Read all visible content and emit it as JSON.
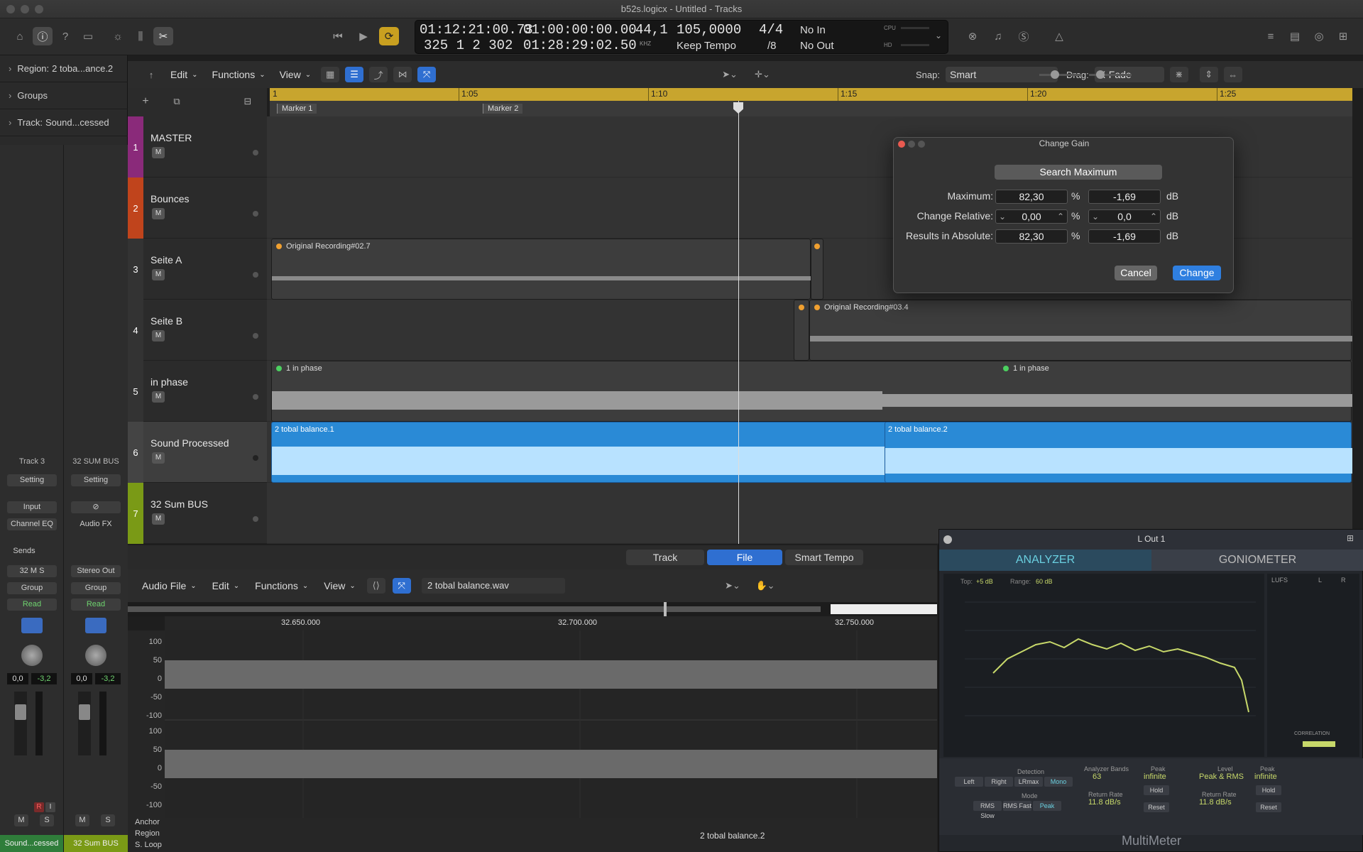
{
  "window": {
    "title": "b52s.logicx - Untitled - Tracks"
  },
  "lcd": {
    "time_main": "01:12:21:00.73",
    "time_bars": "325  1  2  302",
    "time_start": "01:00:00:00.00",
    "time_end": "01:28:29:02.50",
    "sample_rate": "44,1",
    "sample_rate_unit": "KHZ",
    "tempo": "105,0000",
    "tempo_mode": "Keep Tempo",
    "signature_top": "4/4",
    "signature_bottom": "/8",
    "punch_in": "No In",
    "punch_out": "No Out",
    "cpu": "CPU",
    "hd": "HD"
  },
  "inspector": {
    "region_label": "Region:",
    "region_value": "2 toba...ance.2",
    "groups": "Groups",
    "track_label": "Track:",
    "track_value": "Sound...cessed"
  },
  "strips": [
    {
      "name": "Track 3",
      "setting": "Setting",
      "input": "Input",
      "eq": "Channel EQ",
      "sends": "Sends",
      "io": "32 M S",
      "group": "Group",
      "auto": "Read",
      "vol": "0,0",
      "peak": "-3,2",
      "m": "M",
      "s": "S",
      "r": "R",
      "i": "I",
      "footer": "Sound...cessed",
      "footer_color": "#2f7d3a"
    },
    {
      "name": "32 SUM BUS",
      "setting": "Setting",
      "input": "",
      "eq": "Audio FX",
      "sends": "",
      "io": "Stereo Out",
      "group": "Group",
      "auto": "Read",
      "vol": "0,0",
      "peak": "-3,2",
      "m": "M",
      "s": "S",
      "r": "",
      "i": "",
      "footer": "32 Sum BUS",
      "footer_color": "#7a9a16"
    }
  ],
  "track_toolbar": {
    "edit": "Edit",
    "functions": "Functions",
    "view": "View",
    "snap_label": "Snap:",
    "snap_value": "Smart",
    "drag_label": "Drag:",
    "drag_value": "X-Fade"
  },
  "ruler": {
    "labels": [
      "1",
      "1:05",
      "1:10",
      "1:15",
      "1:20",
      "1:25"
    ],
    "markers": [
      "Marker 1",
      "Marker 2"
    ]
  },
  "tracks": [
    {
      "num": "1",
      "name": "MASTER",
      "m": "M",
      "color": "#8a2a7a"
    },
    {
      "num": "2",
      "name": "Bounces",
      "m": "M",
      "color": "#c0441c"
    },
    {
      "num": "3",
      "name": "Seite A",
      "m": "M",
      "color": "#3a3a3a"
    },
    {
      "num": "4",
      "name": "Seite B",
      "m": "M",
      "color": "#3a3a3a"
    },
    {
      "num": "5",
      "name": "in phase",
      "m": "M",
      "color": "#3a3a3a"
    },
    {
      "num": "6",
      "name": "Sound Processed",
      "m": "M",
      "color": "#3a3a3a"
    },
    {
      "num": "7",
      "name": "32 Sum BUS",
      "m": "M",
      "color": "#7a9a16"
    }
  ],
  "regions": {
    "r3": "Original Recording#02.7",
    "r4": "Original Recording#03.4",
    "r5a": "1 in phase",
    "r5b": "1 in phase",
    "r6a": "2 tobal balance.1",
    "r6b": "2 tobal balance.2"
  },
  "change_gain": {
    "title": "Change Gain",
    "search": "Search Maximum",
    "max_label": "Maximum:",
    "max_pct": "82,30",
    "max_db": "-1,69",
    "rel_label": "Change Relative:",
    "rel_pct": "0,00",
    "rel_db": "0,0",
    "abs_label": "Results in Absolute:",
    "abs_pct": "82,30",
    "abs_db": "-1,69",
    "pct": "%",
    "db": "dB",
    "cancel": "Cancel",
    "change": "Change"
  },
  "editor": {
    "tab_track": "Track",
    "tab_file": "File",
    "tab_smart": "Smart Tempo",
    "audio_file": "Audio File",
    "edit": "Edit",
    "functions": "Functions",
    "view": "View",
    "filename": "2 tobal balance.wav",
    "ruler": [
      "32.650.000",
      "32.700.000",
      "32.750.000"
    ],
    "axis": [
      "100",
      "50",
      "0",
      "-50",
      "-100",
      "100",
      "50",
      "0",
      "-50",
      "-100"
    ],
    "anchor": "Anchor",
    "region": "Region",
    "sloop": "S. Loop",
    "region_name": "2 tobal balance.2"
  },
  "multimeter": {
    "title": "L Out 1",
    "tab_analyzer": "ANALYZER",
    "tab_gonio": "GONIOMETER",
    "top_label": "Top:",
    "top_value": "+5 dB",
    "range_label": "Range:",
    "range_value": "60 dB",
    "lufs": "LUFS",
    "l": "L",
    "r": "R",
    "correlation": "CORRELATION",
    "detection": "Detection",
    "det_left": "Left",
    "det_right": "Right",
    "det_lrmax": "LRmax",
    "det_mono": "Mono",
    "mode": "Mode",
    "mode_rms_slow": "RMS Slow",
    "mode_rms_fast": "RMS Fast",
    "mode_peak": "Peak",
    "bands_label": "Analyzer Bands",
    "bands_value": "63",
    "return_label": "Return Rate",
    "return_value": "11.8 dB/s",
    "peak_label": "Peak",
    "peak_value": "infinite",
    "hold": "Hold",
    "reset": "Reset",
    "level_label": "Level",
    "level_value": "Peak & RMS",
    "return_label2": "Return Rate",
    "return_value2": "11.8 dB/s",
    "peak_label2": "Peak",
    "peak_value2": "infinite",
    "hold2": "Hold",
    "reset2": "Reset",
    "footer": "MultiMeter"
  }
}
